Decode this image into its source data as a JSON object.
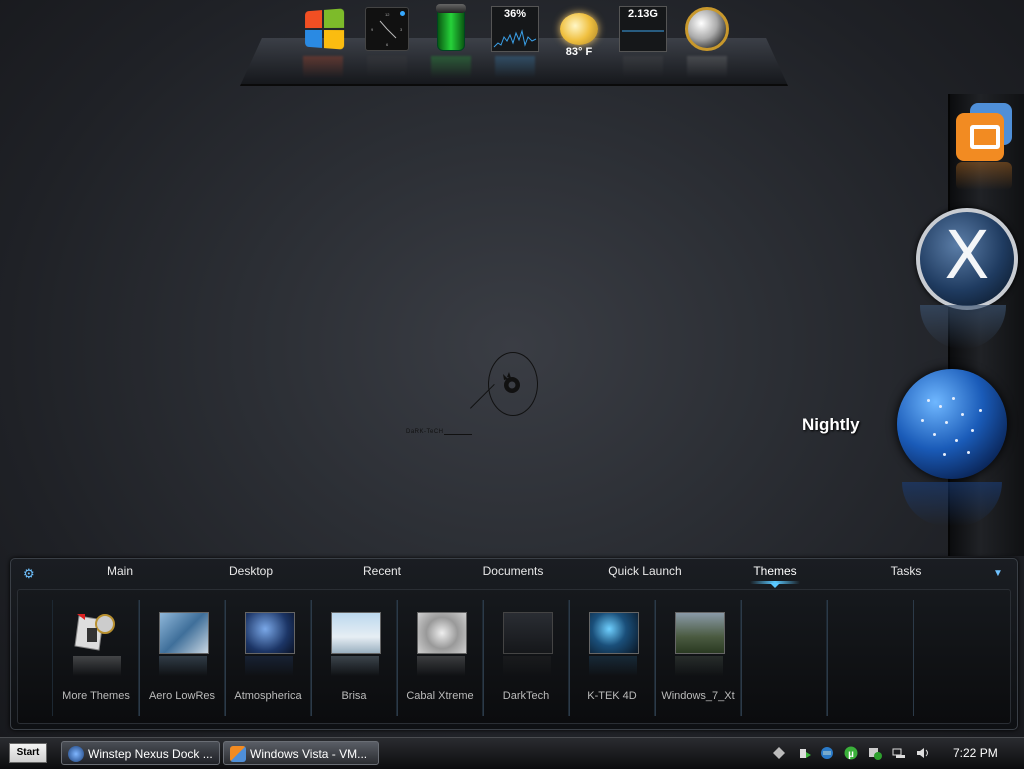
{
  "top_dock": {
    "items": [
      {
        "name": "windows-logo",
        "label": ""
      },
      {
        "name": "clock-gadget",
        "label": ""
      },
      {
        "name": "recycle-bin",
        "label": ""
      },
      {
        "name": "cpu-meter",
        "label": "36%"
      },
      {
        "name": "weather",
        "label": "83° F"
      },
      {
        "name": "drive-meter",
        "label": "2.13G"
      },
      {
        "name": "network-globe",
        "label": ""
      }
    ]
  },
  "desktop": {
    "center_logo_text": "DaRK-TeCH"
  },
  "right_dock": {
    "items": [
      {
        "name": "vmware",
        "label": ""
      },
      {
        "name": "x-app",
        "label": "X"
      },
      {
        "name": "nightly",
        "label": "Nightly"
      }
    ]
  },
  "panel": {
    "tabs": [
      {
        "label": "Main"
      },
      {
        "label": "Desktop"
      },
      {
        "label": "Recent"
      },
      {
        "label": "Documents"
      },
      {
        "label": "Quick Launch"
      },
      {
        "label": "Themes",
        "active": true
      },
      {
        "label": "Tasks"
      }
    ],
    "themes": [
      {
        "label": "More Themes"
      },
      {
        "label": "Aero LowRes"
      },
      {
        "label": "Atmospherica"
      },
      {
        "label": "Brisa"
      },
      {
        "label": "Cabal Xtreme"
      },
      {
        "label": "DarkTech"
      },
      {
        "label": "K-TEK 4D"
      },
      {
        "label": "Windows_7_Xt"
      }
    ]
  },
  "taskbar": {
    "start_label": "Start",
    "tasks": [
      {
        "label": "Winstep Nexus Dock ..."
      },
      {
        "label": "Windows Vista - VM..."
      }
    ],
    "clock": "7:22 PM"
  },
  "colors": {
    "accent": "#5ac8ff",
    "vm_orange": "#f28b22",
    "vm_blue": "#4f8fd8",
    "bin_green": "#26d23a"
  }
}
